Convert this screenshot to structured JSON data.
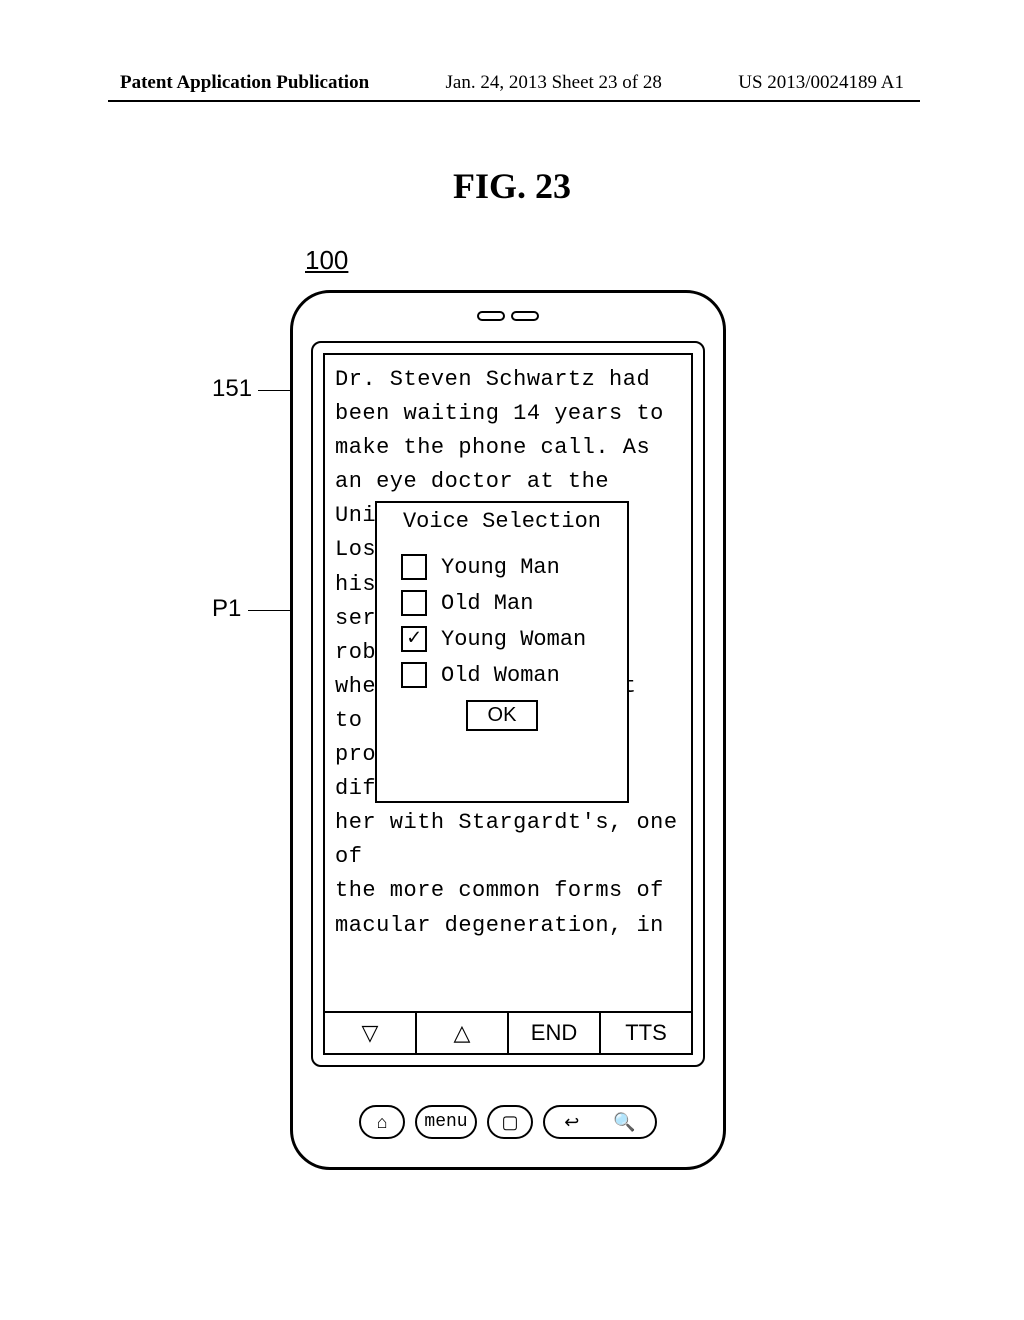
{
  "header": {
    "left": "Patent Application Publication",
    "center": "Jan. 24, 2013  Sheet 23 of 28",
    "right": "US 2013/0024189 A1"
  },
  "figure": {
    "title": "FIG. 23",
    "device_ref": "100",
    "ref_151": "151",
    "ref_p1": "P1"
  },
  "content": {
    "text": "Dr. Steven Schwartz had\nbeen waiting 14 years to\nmake the phone call. As\nan eye doctor at the\nUniv              ,\nLos               es\nhis               th\nseri              wly\nrob               Yet\nwhen              went\nto h              ion\nprob\ndiff              ing\nher with Stargardt's, one of\nthe more common forms of\nmacular degeneration, in"
  },
  "popup": {
    "title": "Voice Selection",
    "options": [
      {
        "label": "Young Man",
        "checked": false
      },
      {
        "label": "Old Man",
        "checked": false
      },
      {
        "label": "Young Woman",
        "checked": true
      },
      {
        "label": "Old Woman",
        "checked": false
      }
    ],
    "ok": "OK"
  },
  "toolbar": {
    "down": "▽",
    "up": "△",
    "end": "END",
    "tts": "TTS"
  },
  "hw": {
    "home": "⌂",
    "menu": "menu",
    "center": "▢",
    "back": "↩",
    "search": "🔍"
  }
}
